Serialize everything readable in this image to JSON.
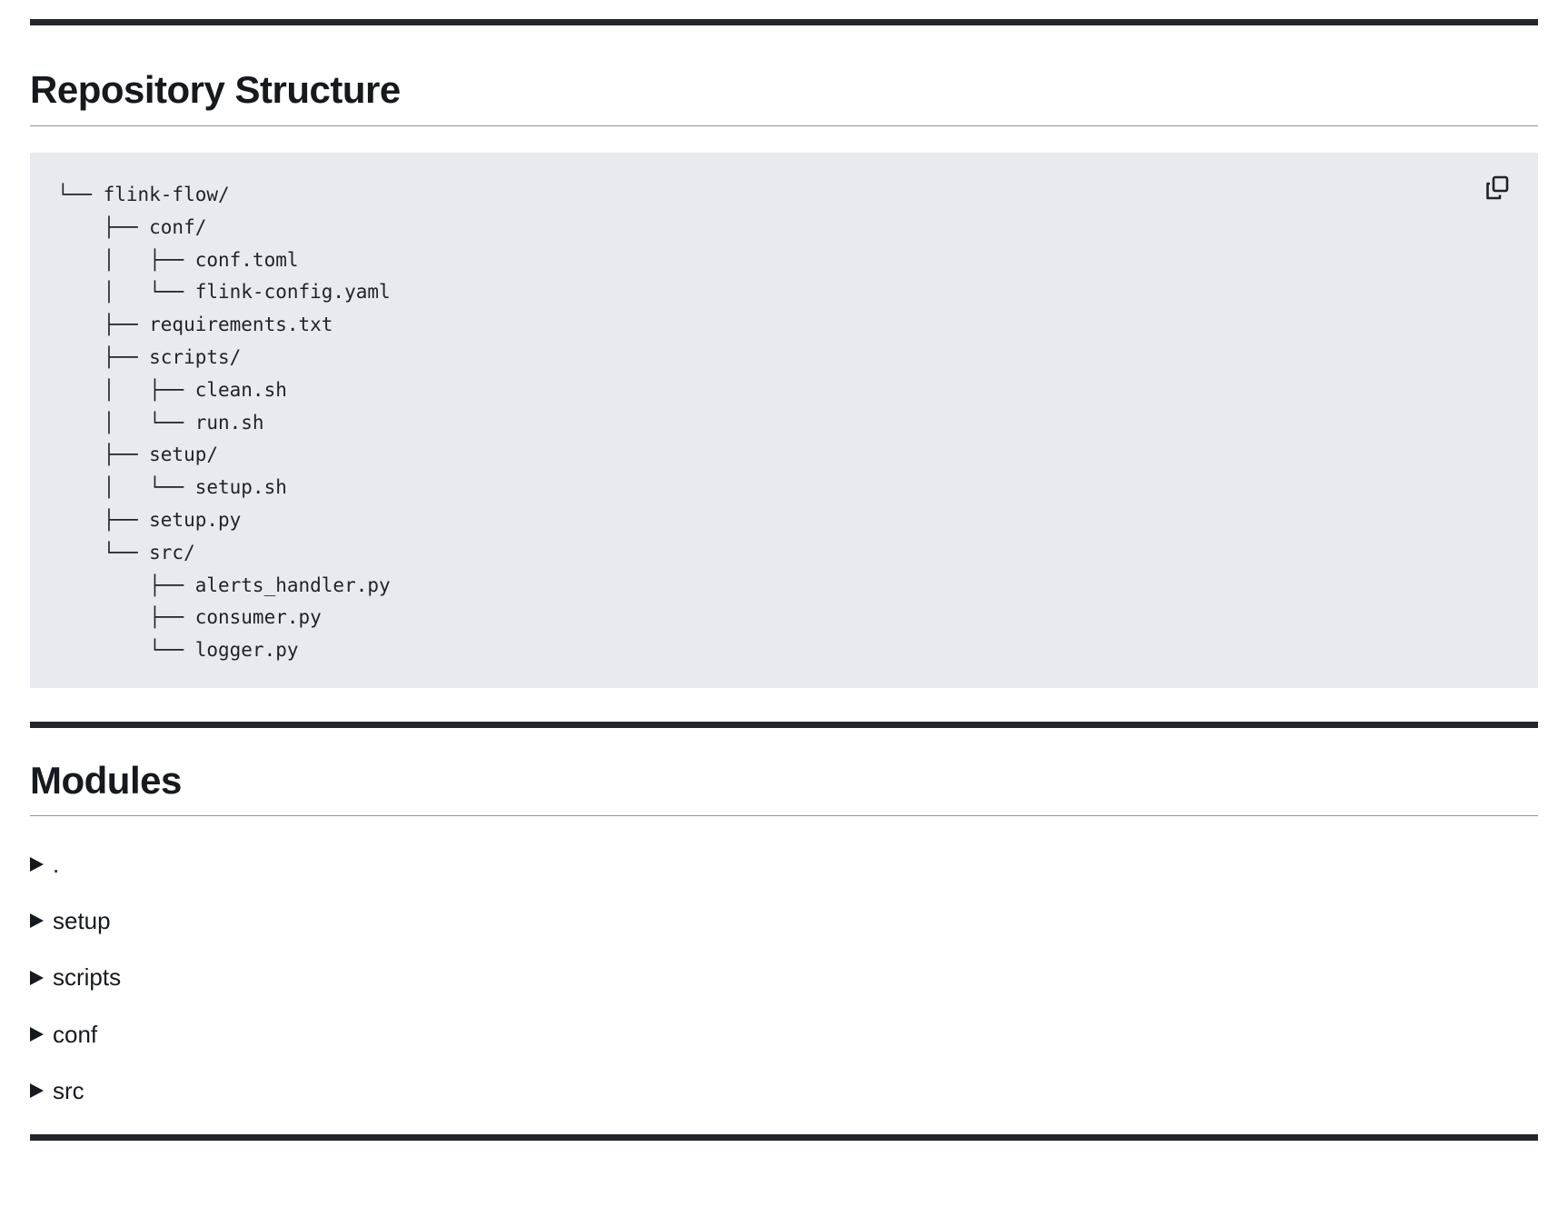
{
  "sections": {
    "repo": {
      "title": "Repository Structure",
      "tree_lines": [
        "└── flink-flow/",
        "    ├── conf/",
        "    │   ├── conf.toml",
        "    │   └── flink-config.yaml",
        "    ├── requirements.txt",
        "    ├── scripts/",
        "    │   ├── clean.sh",
        "    │   └── run.sh",
        "    ├── setup/",
        "    │   └── setup.sh",
        "    ├── setup.py",
        "    └── src/",
        "        ├── alerts_handler.py",
        "        ├── consumer.py",
        "        └── logger.py"
      ],
      "copy_icon": "copy-icon"
    },
    "modules": {
      "title": "Modules",
      "items": [
        ".",
        "setup",
        "scripts",
        "conf",
        "src"
      ],
      "expander_icon": "triangle-right-icon"
    }
  },
  "colors": {
    "text": "#1f2328",
    "code_bg": "#e7ebef",
    "rule": "#22262c"
  }
}
